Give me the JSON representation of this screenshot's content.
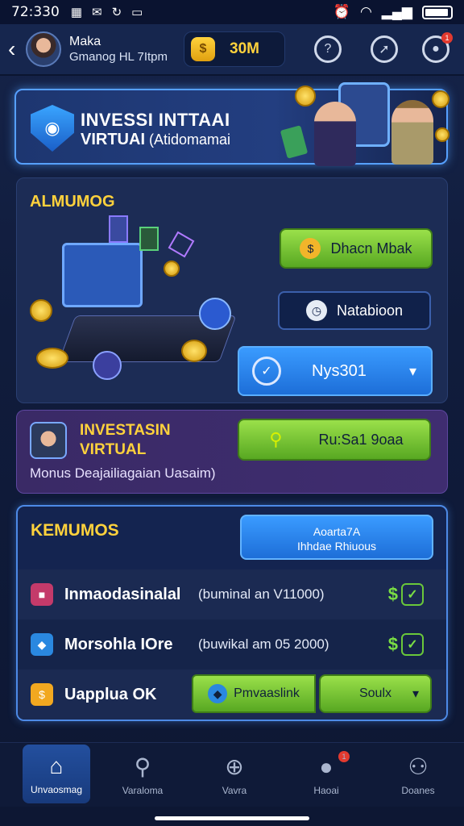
{
  "status_bar": {
    "time": "72:330",
    "icons": [
      "grid-icon",
      "mail-icon",
      "refresh-icon",
      "message-icon"
    ],
    "right_icons": [
      "alarm-icon",
      "wifi-icon",
      "signal-icon",
      "battery-icon"
    ]
  },
  "header": {
    "name": "Maka",
    "subtitle": "Gmanog HL 7Itpm",
    "coins": "30M",
    "icons": [
      "search-icon",
      "compass-icon",
      "profile-icon"
    ],
    "notification_count": "1"
  },
  "banner": {
    "line1": "INVESSI INTTAAI",
    "line2": "VIRTUAI",
    "line2_suffix": "(Atidomamai"
  },
  "card1": {
    "title": "ALMUMOG",
    "btn1": "Dhacn Mbak",
    "btn2": "Natabioon",
    "btn3": "Nys301"
  },
  "card2": {
    "title1": "INVESTASIN",
    "title2": "VIRTUAL",
    "desc": "Monus   Deajailiagaian Uasaim)",
    "btn": "Ru:Sa1 9oaa"
  },
  "card3": {
    "title": "KEMUMOS",
    "action_line1": "Aoarta7A",
    "action_line2": "Ihhdae Rhiuous",
    "rows": [
      {
        "label": "Inmaodasinalal",
        "detail": "(buminal an V11000)",
        "check_prefix": "$"
      },
      {
        "label": "Morsohla IOre",
        "detail": "(buwikal am 05 2000)",
        "check_prefix": "$"
      },
      {
        "label": "Uapplua OK",
        "btn_left": "Pmvaaslink",
        "btn_right": "Soulx"
      }
    ]
  },
  "nav": [
    {
      "label": "Unvaosmag",
      "icon": "home-icon"
    },
    {
      "label": "Varaloma",
      "icon": "search-icon"
    },
    {
      "label": "Vavra",
      "icon": "plus-icon"
    },
    {
      "label": "Haoai",
      "icon": "chat-icon",
      "badge": "1"
    },
    {
      "label": "Doanes",
      "icon": "profile-icon"
    }
  ],
  "colors": {
    "accent": "#ffd23c",
    "primary_blue": "#1d6ed8",
    "success_green": "#6ac83a",
    "background": "#101c3c"
  }
}
